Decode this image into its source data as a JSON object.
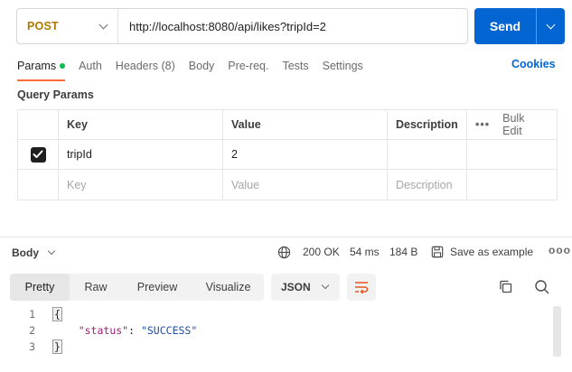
{
  "request": {
    "method": "POST",
    "url": "http://localhost:8080/api/likes?tripId=2",
    "send_label": "Send"
  },
  "tabs": [
    {
      "label": "Params",
      "active": true
    },
    {
      "label": "Auth"
    },
    {
      "label": "Headers (8)"
    },
    {
      "label": "Body"
    },
    {
      "label": "Pre-req."
    },
    {
      "label": "Tests"
    },
    {
      "label": "Settings"
    }
  ],
  "cookies_label": "Cookies",
  "query_params": {
    "title": "Query Params",
    "headers": {
      "key": "Key",
      "value": "Value",
      "description": "Description",
      "bulk_edit": "Bulk Edit"
    },
    "rows": [
      {
        "checked": true,
        "key": "tripId",
        "value": "2",
        "description": ""
      }
    ],
    "placeholder": {
      "key": "Key",
      "value": "Value",
      "description": "Description"
    }
  },
  "response": {
    "body_label": "Body",
    "status": "200 OK",
    "time": "54 ms",
    "size": "184 B",
    "save_label": "Save as example",
    "modes": [
      "Pretty",
      "Raw",
      "Preview",
      "Visualize"
    ],
    "active_mode": "Pretty",
    "format": "JSON",
    "code_lines": [
      {
        "n": "1",
        "text": "{"
      },
      {
        "n": "2",
        "key": "\"status\"",
        "sep": ": ",
        "val": "\"SUCCESS\""
      },
      {
        "n": "3",
        "text": "}"
      }
    ]
  },
  "colors": {
    "accent": "#0265d2",
    "method": "#ad7a03",
    "active_tab": "#ff6c37",
    "dot": "#0cbb52"
  }
}
